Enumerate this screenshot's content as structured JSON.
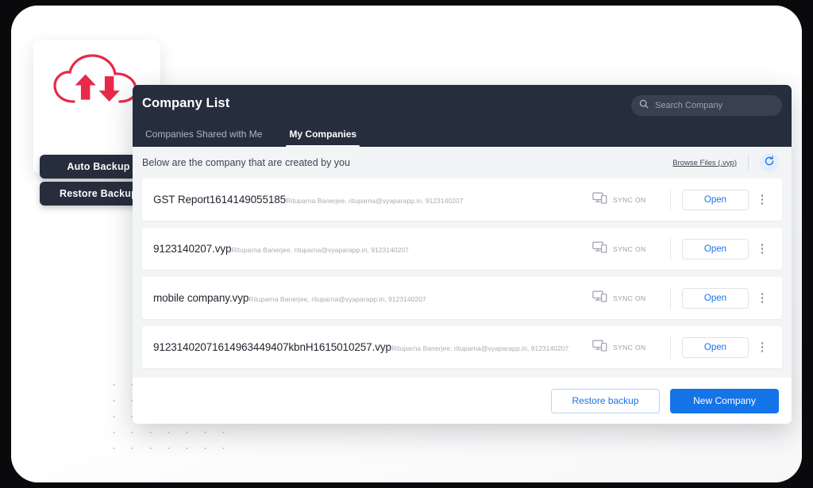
{
  "backup_card": {
    "cloud_icon": "cloud-sync-icon",
    "cloud_color": "#e8294a",
    "auto_backup_label": "Auto Backup",
    "restore_backup_label": "Restore Backup"
  },
  "panel": {
    "title": "Company List",
    "search": {
      "icon": "search-icon",
      "placeholder": "Search Company",
      "value": ""
    },
    "tabs": [
      {
        "label": "Companies Shared with Me",
        "active": false
      },
      {
        "label": "My Companies",
        "active": true
      }
    ],
    "subbar": {
      "text": "Below are the company that are created by you",
      "browse_link": "Browse Files (.vyp)",
      "refresh_icon": "refresh-icon",
      "refresh_color": "#1a73e8"
    },
    "rows": [
      {
        "title": "GST Report1614149055185",
        "subtitle": "Rituparna Banerjee, rituparna@vyaparapp.in, 9123140207",
        "sync_icon": "devices-sync-icon",
        "sync_label": "SYNC ON",
        "open_label": "Open",
        "menu_icon": "kebab-menu-icon"
      },
      {
        "title": "9123140207.vyp",
        "subtitle": "Rituparna Banerjee, rituparna@vyaparapp.in, 9123140207",
        "sync_icon": "devices-sync-icon",
        "sync_label": "SYNC ON",
        "open_label": "Open",
        "menu_icon": "kebab-menu-icon"
      },
      {
        "title": "mobile company.vyp",
        "subtitle": "Rituparna Banerjee, rituparna@vyaparapp.in, 9123140207",
        "sync_icon": "devices-sync-icon",
        "sync_label": "SYNC ON",
        "open_label": "Open",
        "menu_icon": "kebab-menu-icon"
      },
      {
        "title": "91231402071614963449407kbnH1615010257.vyp",
        "subtitle": "Rituparna Banerjee, rituparna@vyaparapp.in, 9123140207",
        "sync_icon": "devices-sync-icon",
        "sync_label": "SYNC ON",
        "open_label": "Open",
        "menu_icon": "kebab-menu-icon"
      }
    ],
    "footer": {
      "restore_backup_label": "Restore backup",
      "new_company_label": "New Company"
    }
  },
  "theme": {
    "header_bg": "#262d3d",
    "page_bg": "#f3f4f6",
    "accent_blue": "#1574e8",
    "accent_red": "#e8294a"
  }
}
